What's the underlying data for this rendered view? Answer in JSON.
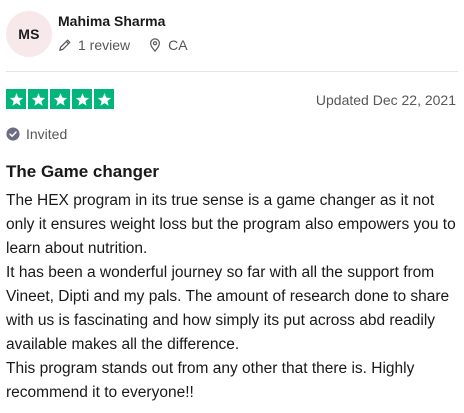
{
  "reviewer": {
    "initials": "MS",
    "name": "Mahima Sharma",
    "review_count": "1 review",
    "country": "CA",
    "icons": [
      "pencil-icon",
      "location-pin-icon"
    ]
  },
  "rating": {
    "stars": 5,
    "out_of": 5,
    "color": "#00b67a"
  },
  "date": "Updated Dec 22, 2021",
  "invited": {
    "label": "Invited",
    "icon": "check-circle-icon"
  },
  "review": {
    "title": "The Game changer",
    "paragraphs": [
      "The HEX program in its true sense is a game changer as it not only it ensures weight loss but the program also empowers you to learn about nutrition.",
      "It has been a wonderful journey so far with all the support from Vineet, Dipti and my pals. The amount of research done to share with us is fascinating and how simply its put across abd readily available makes all the difference.",
      "This program stands out from any other that there is. Highly recommend it to everyone!!"
    ]
  }
}
